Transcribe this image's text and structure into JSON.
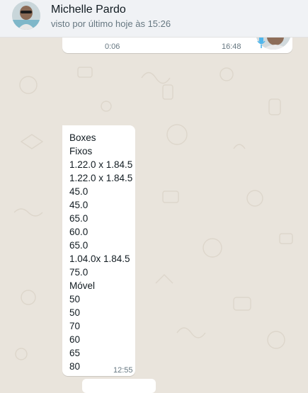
{
  "header": {
    "contact_name": "Michelle Pardo",
    "status": "visto por último hoje às 15:26"
  },
  "audio_message": {
    "duration": "0:06",
    "time": "16:48"
  },
  "text_message": {
    "lines": [
      "Boxes",
      "Fixos",
      "1.22.0 x 1.84.5",
      "1.22.0 x 1.84.5",
      "45.0",
      "45.0",
      "65.0",
      "60.0",
      "65.0",
      "1.04.0x 1.84.5",
      "75.0",
      "Móvel",
      "50",
      "50",
      "70",
      "60",
      "65",
      "80"
    ],
    "time": "12:55"
  },
  "colors": {
    "wallpaper": "#e9e4dc",
    "header_bg": "#f0f2f5",
    "bubble_bg": "#ffffff",
    "meta_text": "#667781",
    "mic_accent": "#4fb6ec"
  },
  "icons": {
    "profile": "avatar",
    "audio_sender": "avatar",
    "voice": "mic-icon"
  }
}
